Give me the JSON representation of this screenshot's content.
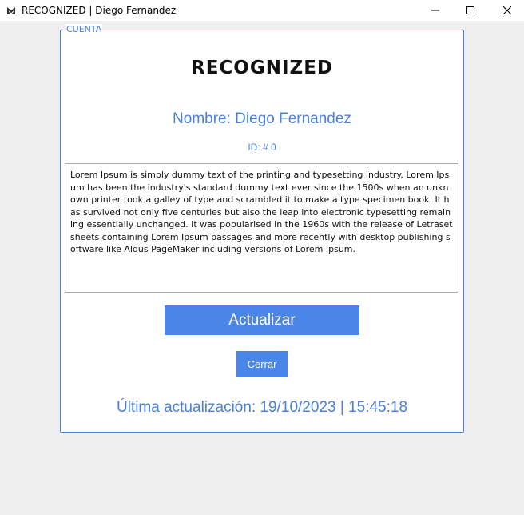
{
  "window": {
    "title": "RECOGNIZED | Diego Fernandez",
    "icons": {
      "app": "app-icon",
      "minimize": "minimize-icon",
      "maximize": "maximize-icon",
      "close": "close-icon"
    }
  },
  "account": {
    "legend": "CUENTA",
    "heading": "RECOGNIZED",
    "name_line": "Nombre: Diego Fernandez",
    "id_line": "ID: # 0",
    "description": "Lorem Ipsum is simply dummy text of the printing and typesetting industry. Lorem Ipsum has been the industry's standard dummy text ever since the 1500s when an unknown printer took a galley of type and scrambled it to make a type specimen book. It has survived not only five centuries but also the leap into electronic typesetting remaining essentially unchanged. It was popularised in the 1960s with the release of Letraset sheets containing Lorem Ipsum passages and more recently with desktop publishing software like Aldus PageMaker including versions of Lorem Ipsum.",
    "update_button": "Actualizar",
    "close_button": "Cerrar",
    "last_update": "Última actualización: 19/10/2023 | 15:45:18"
  },
  "colors": {
    "accent": "#4a7fe0",
    "button": "#4a85e8",
    "background": "#f0f0f0"
  }
}
